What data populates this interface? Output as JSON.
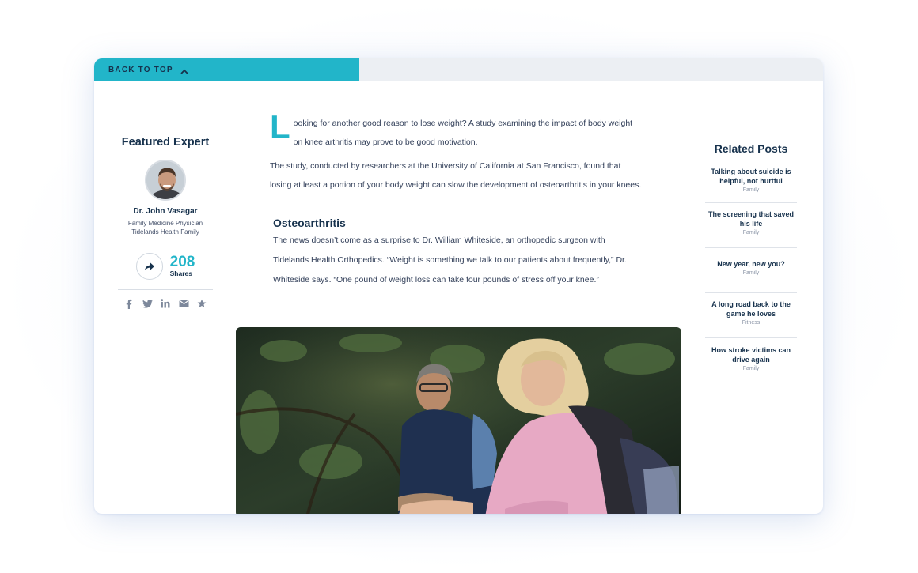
{
  "header": {
    "back_to_top": "BACK TO TOP"
  },
  "expert": {
    "title": "Featured Expert",
    "name": "Dr. John Vasagar",
    "role": "Family Medicine Physician",
    "organization": "Tidelands Health Family",
    "share_count": "208",
    "share_label": "Shares",
    "social_icons": [
      "facebook-icon",
      "twitter-icon",
      "linkedin-icon",
      "email-icon",
      "star-icon"
    ]
  },
  "article": {
    "dropcap": "L",
    "intro": "ooking for another good reason to lose weight? A study examining the impact of body weight on knee arthritis may prove to be good motivation.",
    "paragraph2": "The study, conducted by researchers at the University of California at San Francisco, found that losing at least a portion of your body weight can slow the development of osteoarthritis in your knees.",
    "heading": "Osteoarthritis",
    "paragraph3": "The news doesn’t come as a surprise to Dr. William Whiteside, an orthopedic surgeon with Tidelands Health Orthopedics. “Weight is something we talk to our patients about frequently,” Dr. Whiteside says. “One pound of weight loss can take four pounds of stress off your knee.”"
  },
  "related": {
    "title": "Related Posts",
    "items": [
      {
        "title": "Talking about suicide is helpful, not hurtful",
        "category": "Family"
      },
      {
        "title": "The screening that saved his life",
        "category": "Family"
      },
      {
        "title": "New year, new you?",
        "category": "Family"
      },
      {
        "title": "A long road back to the game he loves",
        "category": "Fitness"
      },
      {
        "title": "How stroke victims can drive again",
        "category": "Family"
      }
    ]
  },
  "colors": {
    "accent": "#22b5c9",
    "navy": "#17324d"
  }
}
